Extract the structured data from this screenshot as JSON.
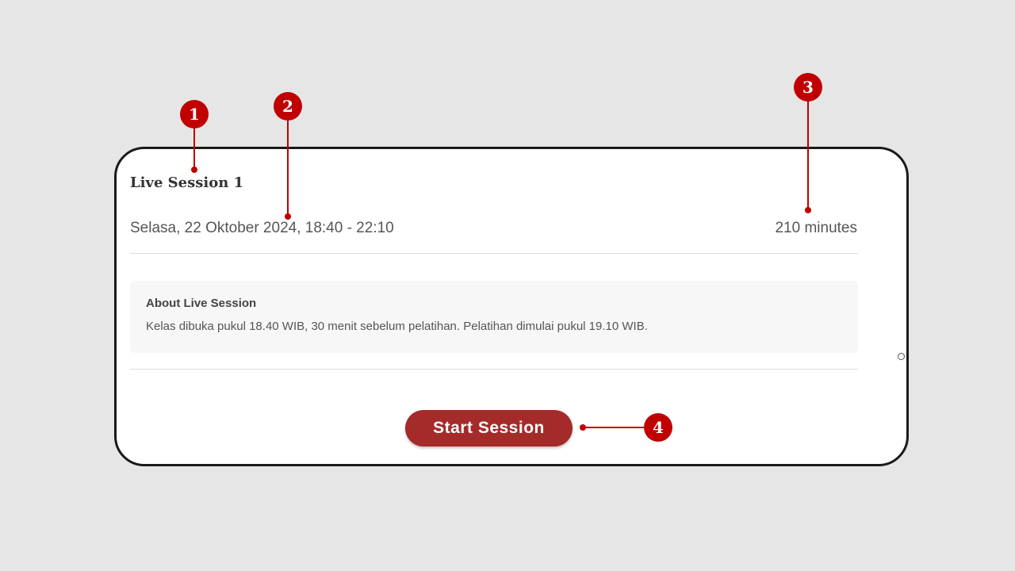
{
  "session": {
    "title": "Live Session 1",
    "date": "Selasa, 22 Oktober 2024, 18:40 - 22:10",
    "duration": "210 minutes"
  },
  "about": {
    "heading": "About Live Session",
    "text": "Kelas dibuka pukul 18.40 WIB, 30 menit sebelum pelatihan. Pelatihan dimulai pukul 19.10 WIB."
  },
  "actions": {
    "start_label": "Start Session"
  },
  "callouts": {
    "badge1": "1",
    "badge2": "2",
    "badge3": "3",
    "badge4": "4"
  },
  "colors": {
    "accent": "#a52a2a",
    "callout": "#c00000",
    "background": "#e6e6e6"
  }
}
